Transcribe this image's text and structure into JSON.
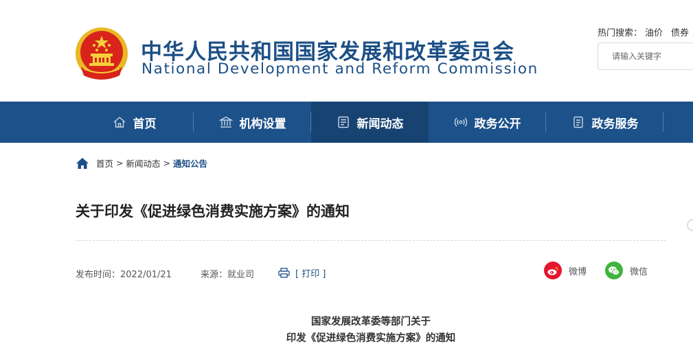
{
  "header": {
    "title_cn": "中华人民共和国国家发展和改革委员会",
    "title_en": "National Development and Reform Commission",
    "hot_search_label": "热门搜索：",
    "hot_keywords": [
      "油价",
      "债券"
    ],
    "search_placeholder": "请输入关键字"
  },
  "nav": {
    "items": [
      {
        "label": "首页",
        "icon": "home-icon"
      },
      {
        "label": "机构设置",
        "icon": "institution-icon"
      },
      {
        "label": "新闻动态",
        "icon": "news-icon",
        "active": true
      },
      {
        "label": "政务公开",
        "icon": "broadcast-icon"
      },
      {
        "label": "政务服务",
        "icon": "document-icon"
      }
    ]
  },
  "breadcrumb": {
    "items": [
      "首页",
      "新闻动态",
      "通知公告"
    ],
    "separator": ">"
  },
  "article": {
    "title": "关于印发《促进绿色消费实施方案》的通知",
    "publish_label": "发布时间：",
    "publish_date": "2022/01/21",
    "source_label": "来源：",
    "source": "就业司",
    "print_label": "[ 打印 ]",
    "share": [
      {
        "label": "微博",
        "icon": "weibo-icon",
        "color": "#e6162d"
      },
      {
        "label": "微信",
        "icon": "wechat-icon",
        "color": "#3fb43f"
      }
    ],
    "doc_heading_1": "国家发展改革委等部门关于",
    "doc_heading_2": "印发《促进绿色消费实施方案》的通知"
  },
  "colors": {
    "brand_blue": "#1c4f86",
    "nav_bg": "#1c5189",
    "nav_active": "#174373"
  }
}
